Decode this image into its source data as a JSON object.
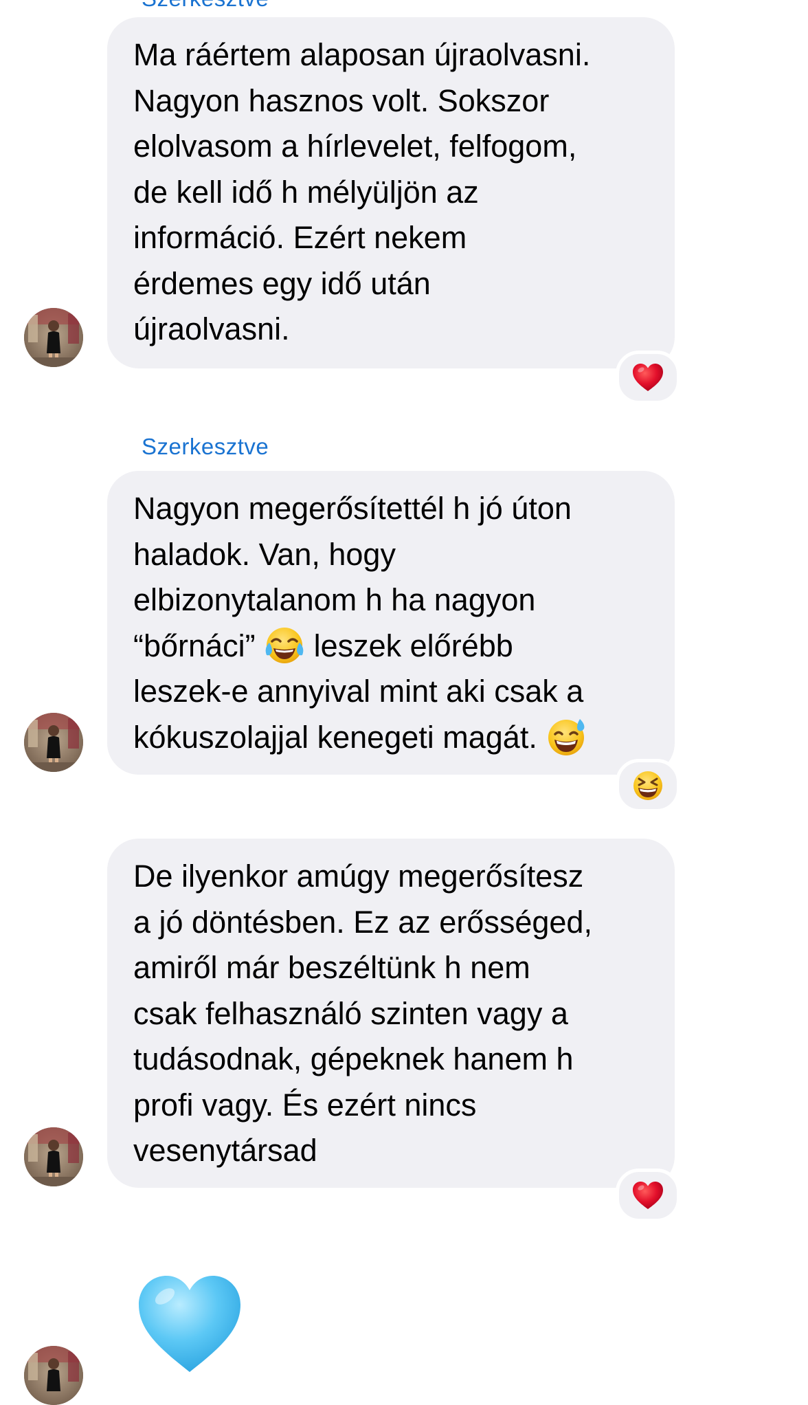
{
  "messages": [
    {
      "edited_label": "Szerkesztve",
      "lines": [
        "Ma ráértem alaposan újraolvasni.",
        "Nagyon hasznos volt. Sokszor",
        "elolvasom a hírlevelet, felfogom,",
        "de kell idő h mélyüljön az",
        "információ. Ezért nekem",
        "érdemes egy idő után",
        "újraolvasni."
      ],
      "reaction": "red-heart-emoji"
    },
    {
      "edited_label": "Szerkesztve",
      "lines": [
        "Nagyon megerősítettél h jó úton",
        "haladok. Van, hogy",
        "elbizonytalanom h ha nagyon",
        "leszek-e annyival mint aki csak a",
        "kókuszolajjal kenegeti magát."
      ],
      "line4_before": "“bőrnáci”",
      "line4_after": "leszek előrébb",
      "inline_emojis": [
        "tears-of-joy-emoji",
        "grinning-sweat-emoji"
      ],
      "reaction": "laughing-squint-emoji"
    },
    {
      "lines": [
        "De ilyenkor amúgy megerősítesz",
        "a jó döntésben. Ez az erősséged,",
        "amiről már beszéltünk h nem",
        "csak felhasználó szinten vagy a",
        "tudásodnak, gépeknek hanem h",
        "profi vagy. És ezért nincs",
        "vesenytársad"
      ],
      "reaction": "red-heart-emoji"
    },
    {
      "emoji_only": "light-blue-heart-emoji"
    }
  ],
  "colors": {
    "bubble": "#f0f0f4",
    "edited_label": "#1a73d1",
    "text": "#000000",
    "heart_red": "#e3102b",
    "heart_blue": "#5cc8f5"
  }
}
